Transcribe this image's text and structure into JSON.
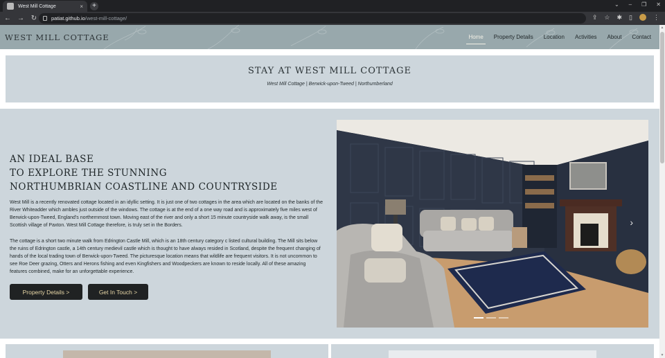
{
  "browser": {
    "tab_title": "West Mill Cottage",
    "tab_close": "×",
    "new_tab": "+",
    "url_host": "patiat.github.io",
    "url_path": "/west-mill-cottage/"
  },
  "site": {
    "brand": "WEST MILL COTTAGE",
    "nav": [
      "Home",
      "Property Details",
      "Location",
      "Activities",
      "About",
      "Contact"
    ]
  },
  "hero": {
    "title": "STAY AT WEST MILL COTTAGE",
    "subtitle": "West Mill Cottage | Berwick-upon-Tweed | Northumberland"
  },
  "intro": {
    "heading_lines": [
      "AN IDEAL BASE",
      "TO EXPLORE THE STUNNING",
      "NORTHUMBRIAN COASTLINE AND COUNTRYSIDE"
    ],
    "paragraph1": "West Mill is a recently renovated cottage located in an idyllic setting. It is just one of two cottages in the area which are located on the banks of the River Whiteadder which ambles just outside of the windows. The cottage is at the end of a one way road and is approximately five miles west of Berwick-upon-Tweed, England's northernmost town. Moving east of the river and only a short 15 minute countryside walk away, is the small Scottish village of Paxton. West Mill Cottage therefore, is truly set in the Borders.",
    "paragraph2": "The cottage is a short two minute walk from Edrington Castle Mill, which is an 18th century category c listed cultural building. The Mill sits below the ruins of Edrington castle, a 14th century medievil castle which is thought to have always resided in Scotland, despite the frequent changing of hands of the local trading town of Berwick-upon-Tweed. The picturesque location means that wildlife are frequent visitors. It is not uncommon to see Roe Deer grazing, Otters and Herons fishing and even Kingfishers and Woodpeckers are known to reside locally. All of these amazing features combined, make for an unforgettable experience.",
    "btn_property": "Property Details >",
    "btn_contact": "Get In Touch >"
  },
  "carousel": {
    "next_glyph": "›",
    "slides": 3,
    "active_slide": 1
  },
  "colors": {
    "header_bg": "#98a8ac",
    "panel_bg": "#cdd6dc",
    "button_bg": "#202223",
    "button_text": "#e8d7a7"
  }
}
